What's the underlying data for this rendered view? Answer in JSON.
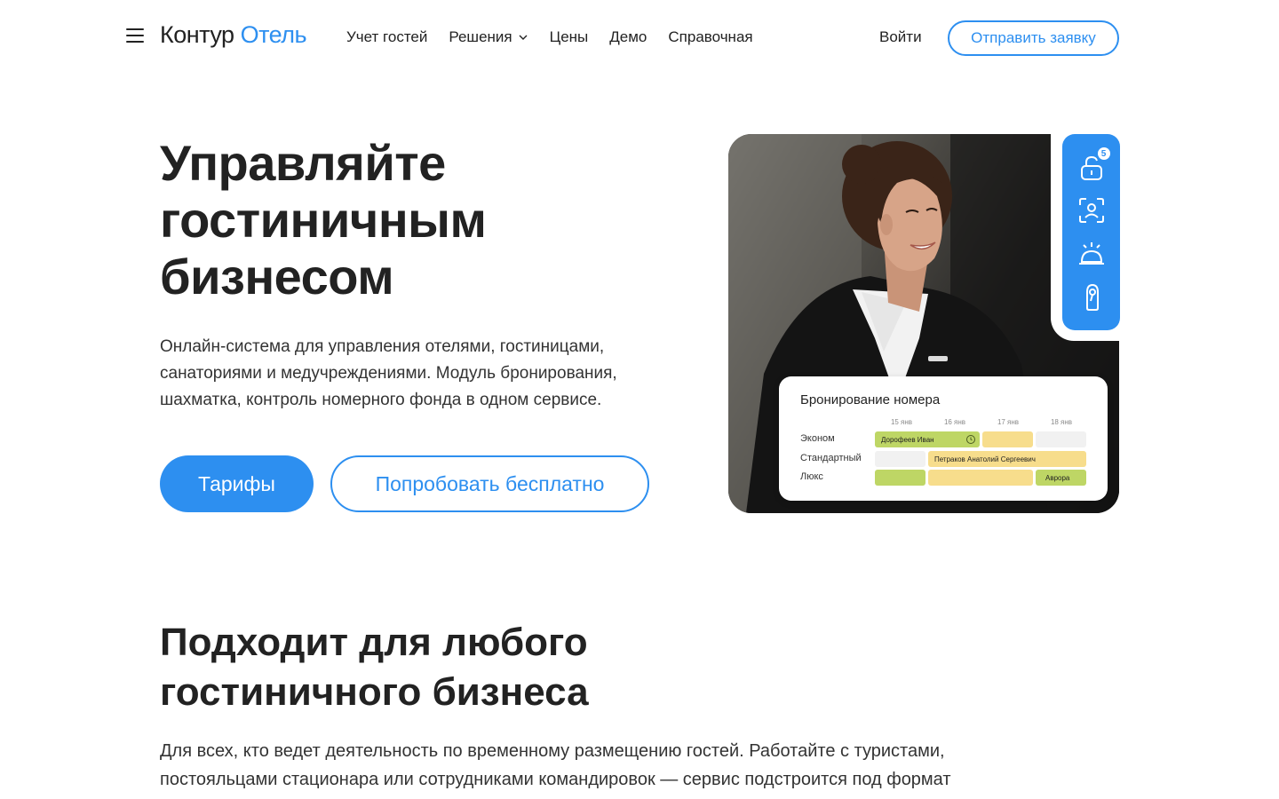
{
  "header": {
    "logo_main": "Контур",
    "logo_accent": "Отель",
    "nav": [
      {
        "label": "Учет гостей"
      },
      {
        "label": "Решения"
      },
      {
        "label": "Цены"
      },
      {
        "label": "Демо"
      },
      {
        "label": "Справочная"
      }
    ],
    "login_label": "Войти",
    "request_label": "Отправить заявку"
  },
  "hero": {
    "title_lines": [
      "Управляйте",
      "гостиничным",
      "бизнесом"
    ],
    "subtitle": "Онлайн-система для управления отелями, гостиницами, санаториями и медучреждениями. Модуль бронирования, шахматка, контроль номерного фонда в одном сервисе.",
    "primary_label": "Тарифы",
    "secondary_label": "Попробовать бесплатно"
  },
  "side_panel": {
    "icons": [
      "lock-icon",
      "face-scan-icon",
      "service-bell-icon",
      "door-hanger-icon"
    ],
    "badge": "5"
  },
  "booking_card": {
    "title": "Бронирование номера",
    "dates": [
      "15 янв",
      "16 янв",
      "17 янв",
      "18 янв"
    ],
    "rows": [
      {
        "label": "Эконом"
      },
      {
        "label": "Стандартный"
      },
      {
        "label": "Люкс"
      }
    ],
    "guests": {
      "econom": "Дорофеев Иван",
      "standard": "Петраков Анатолий Сергеевич",
      "lux": "Аврора"
    },
    "colors": {
      "green": "#bed665",
      "yellow": "#f7dd8c",
      "gray": "#f1f1f1"
    }
  },
  "section2": {
    "title_lines": [
      "Подходит для любого",
      "гостиничного бизнеса"
    ],
    "text": "Для всех, кто ведет деятельность по временному размещению гостей. Работайте с туристами, постояльцами стационара или сотрудниками командировок — сервис подстроится под формат"
  },
  "colors": {
    "accent": "#2d8ff0",
    "text": "#222222"
  }
}
